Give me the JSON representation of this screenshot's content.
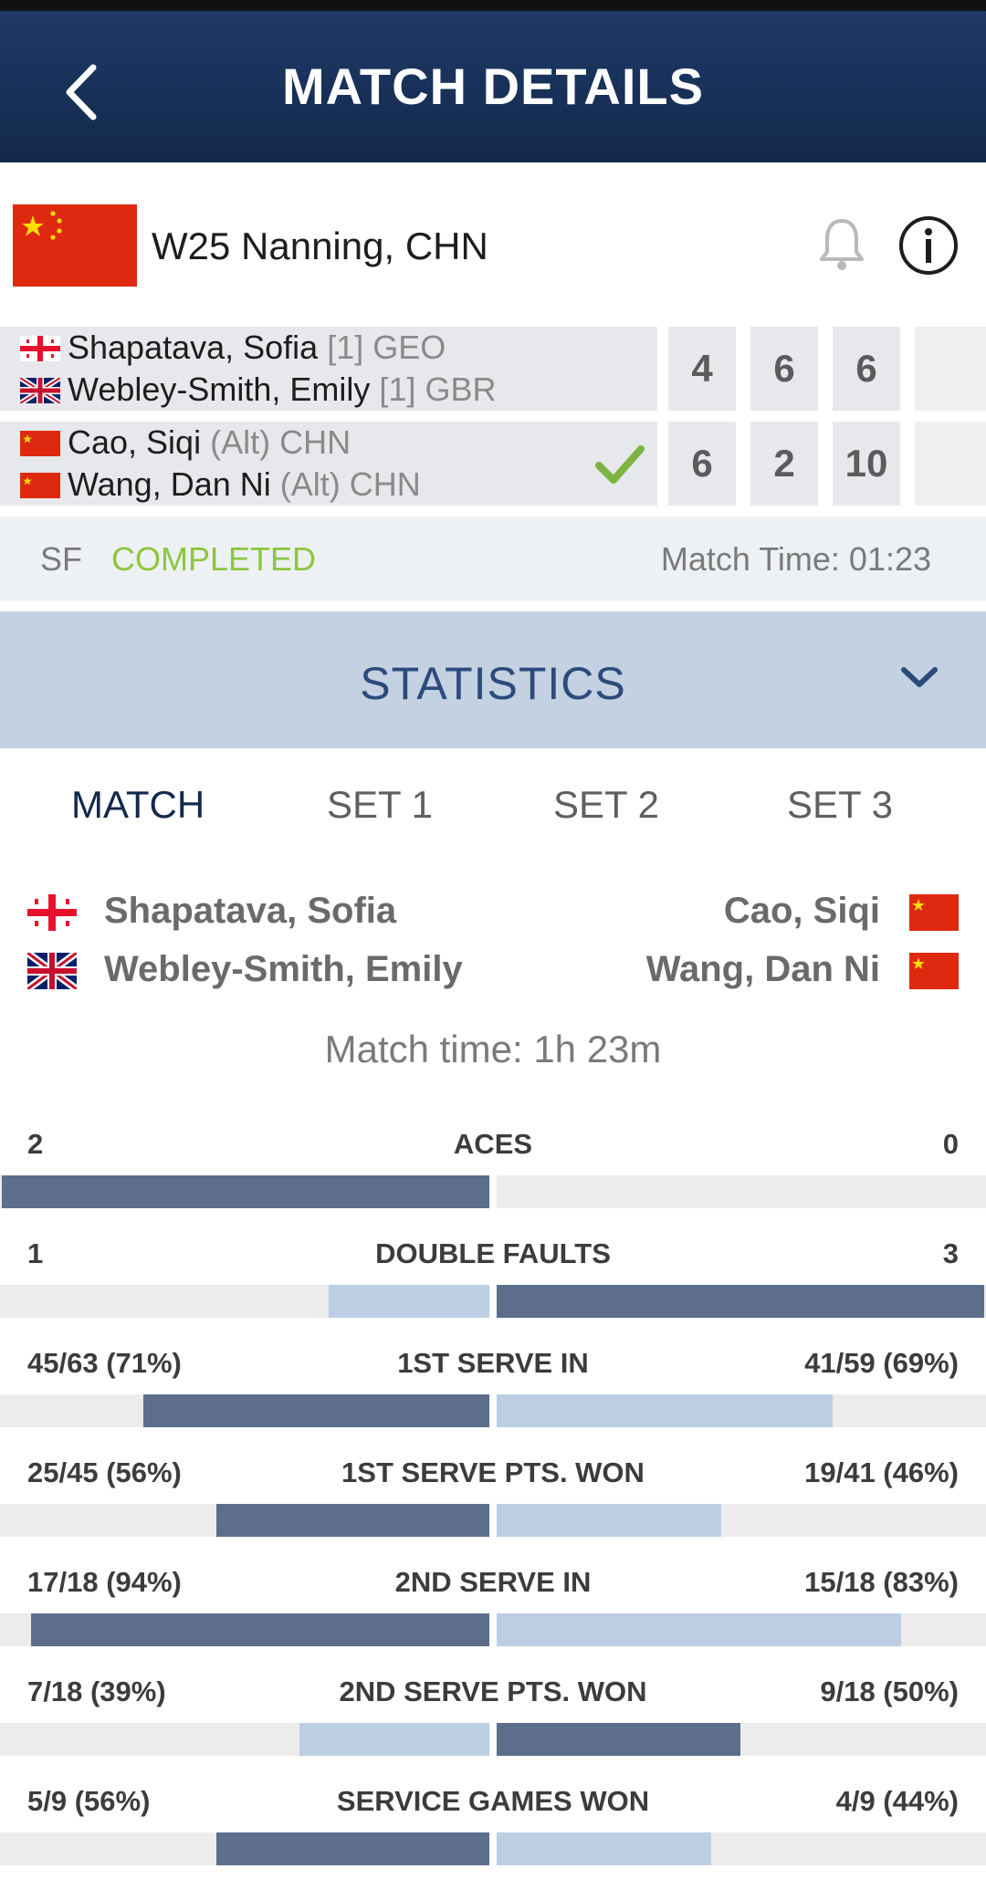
{
  "header": {
    "title": "MATCH DETAILS"
  },
  "tournament": {
    "name": "W25 Nanning, CHN"
  },
  "teams": [
    {
      "players": [
        {
          "name": "Shapatava, Sofia",
          "seed": "[1]",
          "country": "GEO"
        },
        {
          "name": "Webley-Smith, Emily",
          "seed": "[1]",
          "country": "GBR"
        }
      ],
      "scores": [
        "4",
        "6",
        "6"
      ],
      "winner": false
    },
    {
      "players": [
        {
          "name": "Cao, Siqi",
          "seed": "(Alt)",
          "country": "CHN"
        },
        {
          "name": "Wang, Dan Ni",
          "seed": "(Alt)",
          "country": "CHN"
        }
      ],
      "scores": [
        "6",
        "2",
        "10"
      ],
      "winner": true
    }
  ],
  "status": {
    "round": "SF",
    "state": "COMPLETED",
    "match_time": "Match Time: 01:23"
  },
  "statistics": {
    "title": "STATISTICS",
    "tabs": [
      "MATCH",
      "SET 1",
      "SET 2",
      "SET 3"
    ],
    "left_names": [
      "Shapatava, Sofia",
      "Webley-Smith, Emily"
    ],
    "right_names": [
      "Cao, Siqi",
      "Wang, Dan Ni"
    ],
    "match_time": "Match time: 1h 23m",
    "rows": [
      {
        "label": "ACES",
        "left": "2",
        "right": "0",
        "left_frac": 1.0,
        "right_frac": 0.0
      },
      {
        "label": "DOUBLE FAULTS",
        "left": "1",
        "right": "3",
        "left_frac": 0.33,
        "right_frac": 1.0
      },
      {
        "label": "1ST SERVE IN",
        "left": "45/63 (71%)",
        "right": "41/59 (69%)",
        "left_frac": 0.71,
        "right_frac": 0.69
      },
      {
        "label": "1ST SERVE PTS. WON",
        "left": "25/45 (56%)",
        "right": "19/41 (46%)",
        "left_frac": 0.56,
        "right_frac": 0.46
      },
      {
        "label": "2ND SERVE IN",
        "left": "17/18 (94%)",
        "right": "15/18 (83%)",
        "left_frac": 0.94,
        "right_frac": 0.83
      },
      {
        "label": "2ND SERVE PTS. WON",
        "left": "7/18 (39%)",
        "right": "9/18 (50%)",
        "left_frac": 0.39,
        "right_frac": 0.5
      },
      {
        "label": "SERVICE GAMES WON",
        "left": "5/9 (56%)",
        "right": "4/9 (44%)",
        "left_frac": 0.56,
        "right_frac": 0.44
      }
    ]
  },
  "colors": {
    "header_bg": "#13294b",
    "completed": "#8cc63f",
    "bar_dark": "#5c6e8c",
    "bar_light": "#bccee2"
  },
  "icons": [
    "back-arrow-icon",
    "bell-icon",
    "info-icon",
    "checkmark-icon",
    "chevron-down-icon",
    "flag-china-icon",
    "flag-georgia-icon",
    "flag-uk-icon"
  ]
}
